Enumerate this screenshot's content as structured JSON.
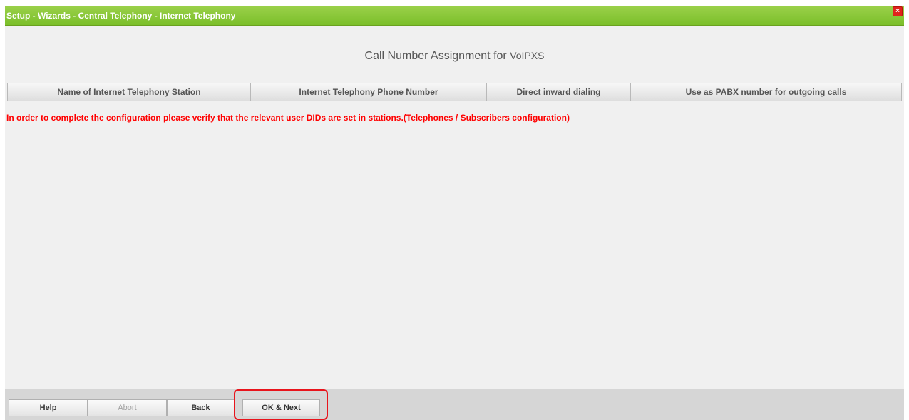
{
  "window": {
    "title": "Setup - Wizards - Central Telephony - Internet Telephony",
    "close_label": "×"
  },
  "heading": {
    "main": "Call Number Assignment for ",
    "provider": "VoIPXS"
  },
  "table": {
    "columns": [
      "Name of Internet Telephony Station",
      "Internet Telephony Phone Number",
      "Direct inward dialing",
      "Use as PABX number for outgoing calls"
    ]
  },
  "message": "In order to complete the configuration please verify that the relevant user DIDs are set in stations.(Telephones / Subscribers configuration)",
  "footer": {
    "help": "Help",
    "abort": "Abort",
    "back": "Back",
    "ok_next": "OK & Next"
  },
  "colors": {
    "titlebar": "#7bbf2a",
    "message": "#ff0000",
    "highlight": "#e8141c"
  }
}
